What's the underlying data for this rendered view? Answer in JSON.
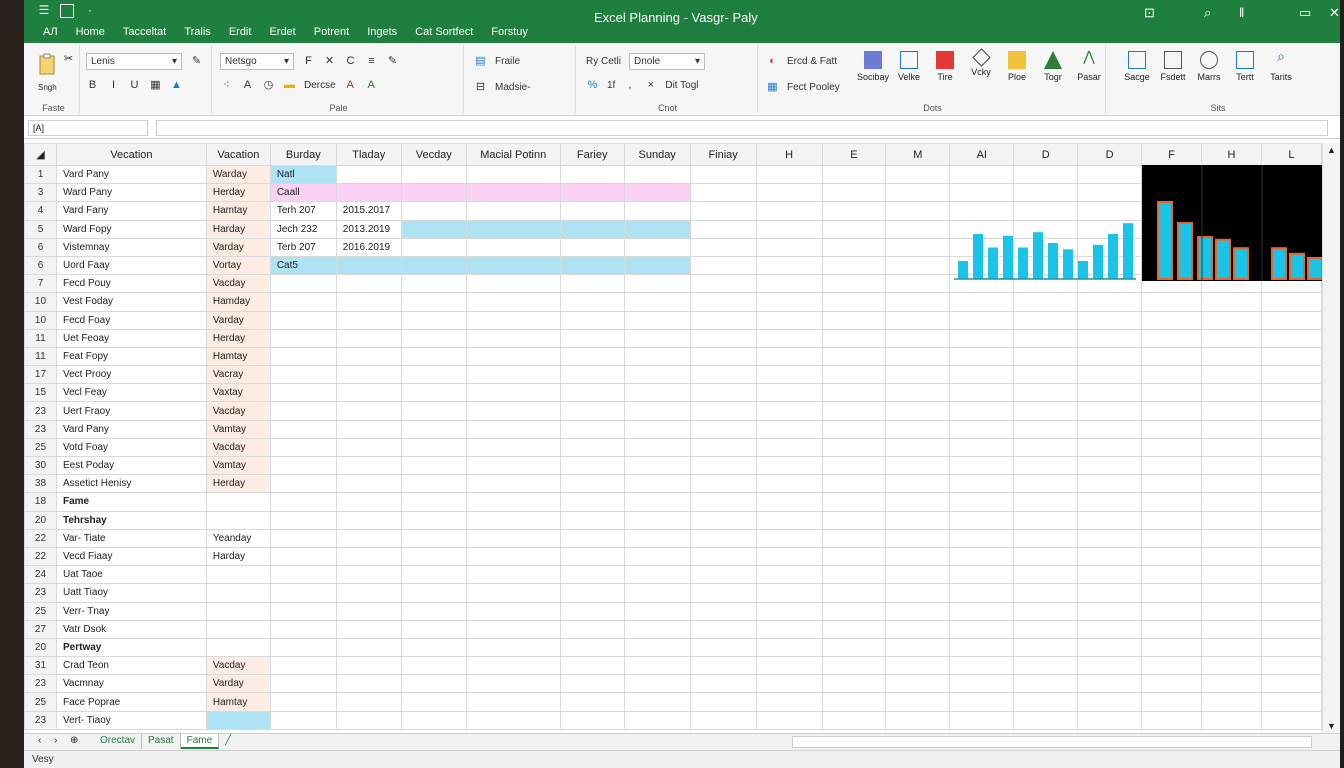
{
  "window": {
    "title": "Excel Planning  -  Vasgr- Paly",
    "menu": [
      "AЛ",
      "Home",
      "Tacceltat",
      "Tralis",
      "Erdit",
      "Erdet",
      "Potrent",
      "Ingets",
      "Cat Sortfect",
      "Forstuy"
    ]
  },
  "ribbon": {
    "clipboard": {
      "label": "Faste",
      "paste_glyph": "Sngh"
    },
    "font": {
      "name_dd": "Lenis",
      "style_dd": "Netsgo",
      "style_btn": "Dercse",
      "label": "Pale"
    },
    "alignment": {
      "label": "Fraile",
      "wrap": "Madsie-"
    },
    "number": {
      "dd1": "Ry Cetli",
      "dd2": "Dnole",
      "label": "Cnot",
      "dec": "Dit Togl",
      "vals": "1f"
    },
    "styles": {
      "row1": "Ercd & Fatt",
      "row2": "Fect Pooley",
      "btns": [
        "Socibay",
        "Velke",
        "Tire",
        "Vcky",
        "Ploe",
        "Togr"
      ],
      "extra": "Pasar",
      "label": "Dots"
    },
    "cells": {
      "btns": [
        "Sacge",
        "Fsdett",
        "Marrs",
        "Tertt",
        "Tarits"
      ],
      "label": "Sits"
    }
  },
  "formula_bar": {
    "namebox": "[A]",
    "value": ""
  },
  "columns": [
    "Vecation",
    "Vacation",
    "Burday",
    "Tladay",
    "Vecday",
    "Macial Potinn",
    "Fariey",
    "Sunday",
    "Finiay",
    "H",
    "E",
    "M",
    "AI",
    "D",
    "D",
    "F",
    "H",
    "L"
  ],
  "rows": [
    {
      "n": "1",
      "a": "Vard Pany",
      "b": "Warday",
      "c": "Natl"
    },
    {
      "n": "3",
      "a": "Ward Pany",
      "b": "Herday",
      "c": "Caall"
    },
    {
      "n": "4",
      "a": "Vard Fany",
      "b": "Hamtay",
      "c": "Terh 207",
      "d": "2015.2017"
    },
    {
      "n": "5",
      "a": "Ward Fopy",
      "b": "Harday",
      "c": "Jech 232",
      "d": "2013.2019"
    },
    {
      "n": "6",
      "a": "Vistemnay",
      "b": "Varday",
      "c": "Terb 207",
      "d": "2016.2019"
    },
    {
      "n": "6",
      "a": "Uord Faay",
      "b": "Vortay",
      "c": "Cat5"
    },
    {
      "n": "7",
      "a": "Fecd Pouy",
      "b": "Vacday"
    },
    {
      "n": "10",
      "a": "Vest Foday",
      "b": "Hamday"
    },
    {
      "n": "10",
      "a": "Fecd Foay",
      "b": "Varday"
    },
    {
      "n": "11",
      "a": "Uet Feoay",
      "b": "Herday"
    },
    {
      "n": "11",
      "a": "Feat Fopy",
      "b": "Hamtay"
    },
    {
      "n": "17",
      "a": "Vect Prooy",
      "b": "Vacray"
    },
    {
      "n": "15",
      "a": "Vecl Feay",
      "b": "Vaxtay"
    },
    {
      "n": "23",
      "a": "Uert Fraoy",
      "b": "Vacday"
    },
    {
      "n": "23",
      "a": "Vard Pany",
      "b": "Vamtay"
    },
    {
      "n": "25",
      "a": "Votd Foay",
      "b": "Vacday"
    },
    {
      "n": "30",
      "a": "Eest Poday",
      "b": "Vamtay"
    },
    {
      "n": "38",
      "a": "Assetict Henisy",
      "b": "Herday"
    },
    {
      "n": "18",
      "a": "Fame",
      "bold": true
    },
    {
      "n": "20",
      "a": "Tehrshay",
      "bold": true
    },
    {
      "n": "22",
      "a": "Var- Tiate",
      "b": "Yeanday"
    },
    {
      "n": "22",
      "a": "Vecd Fiaay",
      "b": "Harday"
    },
    {
      "n": "24",
      "a": "Uat Taoe"
    },
    {
      "n": "23",
      "a": "Uatt Tiaoy"
    },
    {
      "n": "25",
      "a": "Verr- Tnay"
    },
    {
      "n": "27",
      "a": "Vatr Dsok"
    },
    {
      "n": "20",
      "a": "Pertway",
      "bold": true
    },
    {
      "n": "31",
      "a": "Crad Teon",
      "b": "Vacday"
    },
    {
      "n": "23",
      "a": "Vacmnay",
      "b": "Varday"
    },
    {
      "n": "25",
      "a": "Face Poprae",
      "b": "Hamtay"
    },
    {
      "n": "23",
      "a": "Vert- Tiaoy"
    }
  ],
  "sheet_tabs": [
    "Orectav",
    "Pasat",
    "Fame"
  ],
  "status": "Vesy",
  "colors": {
    "green": "#1e7f3e",
    "cyan": "#19c4e8",
    "orange": "#e8662a"
  },
  "chart_a": {
    "values": [
      20,
      50,
      35,
      48,
      35,
      52,
      40,
      33,
      20,
      38,
      50,
      62
    ]
  },
  "chart_b": {
    "values": [
      55,
      40,
      30,
      28,
      22,
      22,
      18,
      15
    ]
  }
}
